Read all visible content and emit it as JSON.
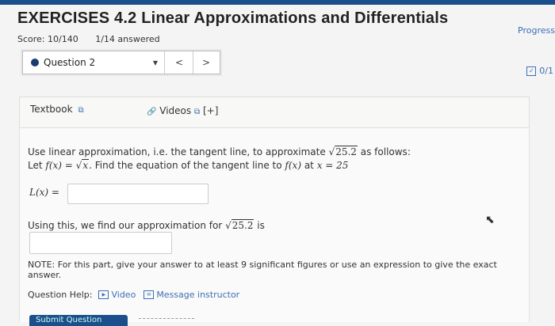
{
  "header": {
    "title": "EXERCISES 4.2 Linear Approximations and Differentials",
    "score": "Score: 10/140",
    "answered": "1/14 answered",
    "progress_label": "Progress"
  },
  "question_nav": {
    "selected": "Question 2",
    "prev": "<",
    "next": ">",
    "score_label": "0/1"
  },
  "resources": {
    "textbook": "Textbook",
    "videos": "Videos",
    "videos_extra": "[+]"
  },
  "problem": {
    "line1_prefix": "Use linear approximation, i.e. the tangent line, to approximate",
    "line1_radicand": "25.2",
    "line1_suffix": "as follows:",
    "line2_prefix": "Let",
    "line2_fx": "f(x) = ",
    "line2_sqrt": "x",
    "line2_mid": ". Find the equation of the tangent line to",
    "line2_fx2": "f(x)",
    "line2_at": "at",
    "line2_x": "x = 25",
    "lx_label": "L(x) =",
    "approx_prefix": "Using this, we find our approximation for",
    "approx_radicand": "25.2",
    "approx_suffix": "is",
    "note": "NOTE: For this part, give your answer to at least 9 significant figures or use an expression to give the exact answer."
  },
  "help": {
    "label": "Question Help:",
    "video": "Video",
    "message": "Message instructor"
  },
  "submit": {
    "label": "Submit Question"
  }
}
